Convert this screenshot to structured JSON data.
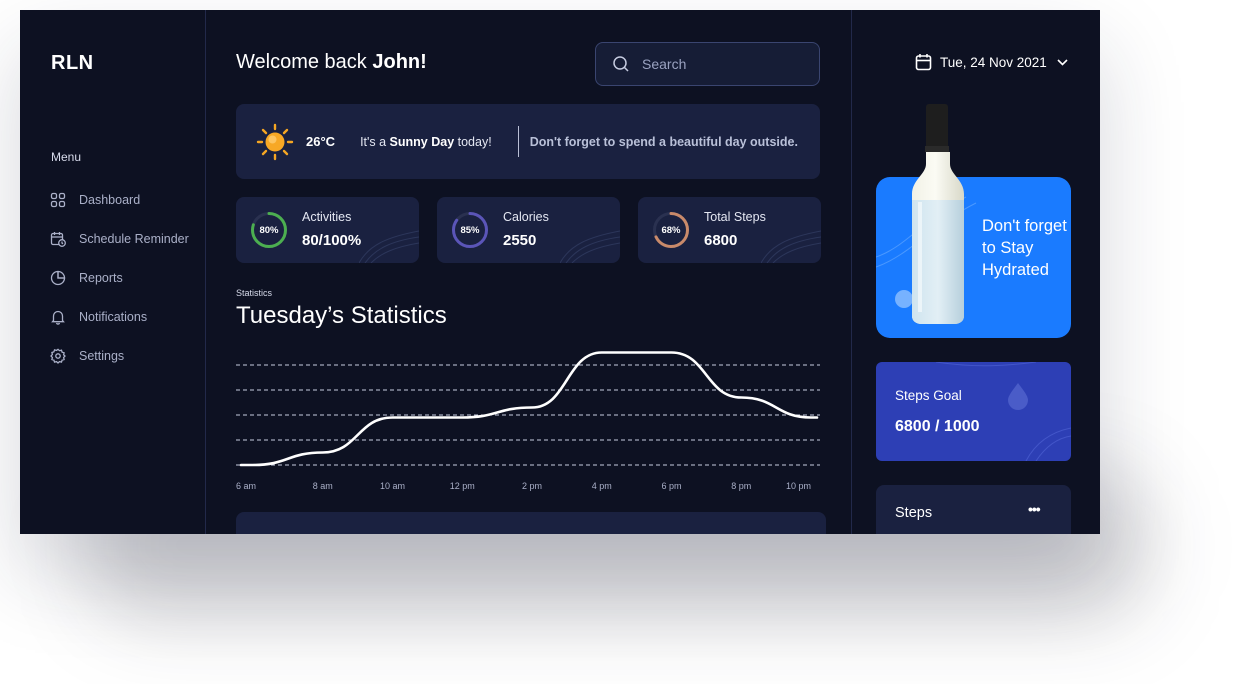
{
  "app": {
    "logo": "RLN"
  },
  "sidebar": {
    "menu_label": "Menu",
    "items": [
      {
        "label": "Dashboard",
        "icon": "grid-icon"
      },
      {
        "label": "Schedule Reminder",
        "icon": "calendar-clock-icon"
      },
      {
        "label": "Reports",
        "icon": "pie-chart-icon"
      },
      {
        "label": "Notifications",
        "icon": "bell-icon"
      },
      {
        "label": "Settings",
        "icon": "gear-icon"
      }
    ]
  },
  "header": {
    "welcome_prefix": "Welcome back ",
    "user_name": "John!",
    "search_placeholder": "Search"
  },
  "weather": {
    "temp_value": "26",
    "temp_unit": "°C",
    "sunny_prefix": "It's a ",
    "sunny_bold": "Sunny Day",
    "sunny_suffix": " today!",
    "tip": "Don't forget to spend a beautiful day outside."
  },
  "stats_cards": [
    {
      "label": "Activities",
      "value": "80/100%",
      "percent_text": "80%",
      "progress": 0.8,
      "color": "#4caf50"
    },
    {
      "label": "Calories",
      "value": "2550",
      "percent_text": "85%",
      "progress": 0.85,
      "color": "#5b55b8"
    },
    {
      "label": "Total Steps",
      "value": "6800",
      "percent_text": "68%",
      "progress": 0.68,
      "color": "#c98a6a"
    }
  ],
  "statistics": {
    "small_label": "Statistics",
    "title": "Tuesday’s Statistics"
  },
  "chart_data": {
    "type": "line",
    "x": [
      "6 am",
      "8 am",
      "10 am",
      "12 pm",
      "2 pm",
      "4 pm",
      "6 pm",
      "8 pm",
      "10 pm"
    ],
    "series": [
      {
        "values": [
          0.2,
          0.7,
          2.1,
          2.1,
          2.5,
          4.7,
          4.7,
          2.9,
          2.1
        ]
      }
    ],
    "grid": "dashed horizontal",
    "ylim": [
      0,
      5
    ]
  },
  "right": {
    "date": "Tue, 24 Nov 2021",
    "hydrate_text": "Don't forget to Stay Hydrated",
    "steps_goal_label": "Steps Goal",
    "steps_goal_value": "6800 / 1000",
    "steps_label": "Steps",
    "more_label": "•••"
  },
  "colors": {
    "background": "#0d1122",
    "panel": "#1a2140",
    "accent_blue": "#1a7bff",
    "steps_goal": "#2d3fb5"
  }
}
